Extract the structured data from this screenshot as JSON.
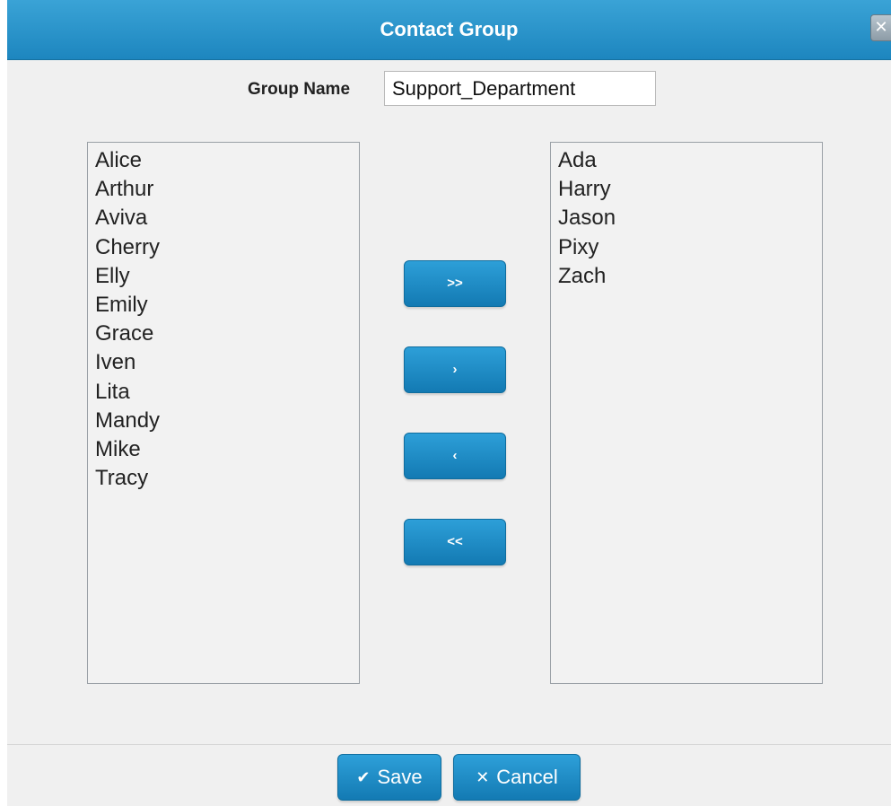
{
  "dialog": {
    "title": "Contact Group",
    "close_icon": "✕"
  },
  "group_name": {
    "label": "Group Name",
    "value": "Support_Department"
  },
  "available_contacts": [
    "Alice",
    "Arthur",
    "Aviva",
    "Cherry",
    "Elly",
    "Emily",
    "Grace",
    "Iven",
    "Lita",
    "Mandy",
    "Mike",
    "Tracy"
  ],
  "selected_contacts": [
    "Ada",
    "Harry",
    "Jason",
    "Pixy",
    "Zach"
  ],
  "move_buttons": {
    "add_all": ">>",
    "add_one": "›",
    "remove_one": "‹",
    "remove_all": "<<"
  },
  "footer": {
    "save_icon": "✔",
    "save_label": "Save",
    "cancel_icon": "✕",
    "cancel_label": "Cancel"
  },
  "colors": {
    "accent": "#1d86bf",
    "button": "#2d9fd8"
  }
}
